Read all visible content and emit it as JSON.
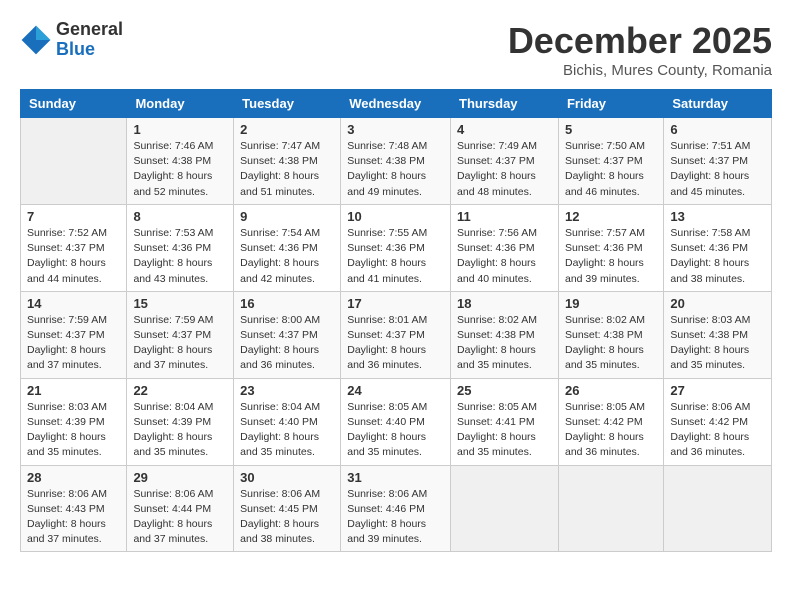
{
  "logo": {
    "general": "General",
    "blue": "Blue"
  },
  "title": "December 2025",
  "subtitle": "Bichis, Mures County, Romania",
  "days_of_week": [
    "Sunday",
    "Monday",
    "Tuesday",
    "Wednesday",
    "Thursday",
    "Friday",
    "Saturday"
  ],
  "weeks": [
    [
      {
        "day": "",
        "info": ""
      },
      {
        "day": "1",
        "info": "Sunrise: 7:46 AM\nSunset: 4:38 PM\nDaylight: 8 hours\nand 52 minutes."
      },
      {
        "day": "2",
        "info": "Sunrise: 7:47 AM\nSunset: 4:38 PM\nDaylight: 8 hours\nand 51 minutes."
      },
      {
        "day": "3",
        "info": "Sunrise: 7:48 AM\nSunset: 4:38 PM\nDaylight: 8 hours\nand 49 minutes."
      },
      {
        "day": "4",
        "info": "Sunrise: 7:49 AM\nSunset: 4:37 PM\nDaylight: 8 hours\nand 48 minutes."
      },
      {
        "day": "5",
        "info": "Sunrise: 7:50 AM\nSunset: 4:37 PM\nDaylight: 8 hours\nand 46 minutes."
      },
      {
        "day": "6",
        "info": "Sunrise: 7:51 AM\nSunset: 4:37 PM\nDaylight: 8 hours\nand 45 minutes."
      }
    ],
    [
      {
        "day": "7",
        "info": "Sunrise: 7:52 AM\nSunset: 4:37 PM\nDaylight: 8 hours\nand 44 minutes."
      },
      {
        "day": "8",
        "info": "Sunrise: 7:53 AM\nSunset: 4:36 PM\nDaylight: 8 hours\nand 43 minutes."
      },
      {
        "day": "9",
        "info": "Sunrise: 7:54 AM\nSunset: 4:36 PM\nDaylight: 8 hours\nand 42 minutes."
      },
      {
        "day": "10",
        "info": "Sunrise: 7:55 AM\nSunset: 4:36 PM\nDaylight: 8 hours\nand 41 minutes."
      },
      {
        "day": "11",
        "info": "Sunrise: 7:56 AM\nSunset: 4:36 PM\nDaylight: 8 hours\nand 40 minutes."
      },
      {
        "day": "12",
        "info": "Sunrise: 7:57 AM\nSunset: 4:36 PM\nDaylight: 8 hours\nand 39 minutes."
      },
      {
        "day": "13",
        "info": "Sunrise: 7:58 AM\nSunset: 4:36 PM\nDaylight: 8 hours\nand 38 minutes."
      }
    ],
    [
      {
        "day": "14",
        "info": "Sunrise: 7:59 AM\nSunset: 4:37 PM\nDaylight: 8 hours\nand 37 minutes."
      },
      {
        "day": "15",
        "info": "Sunrise: 7:59 AM\nSunset: 4:37 PM\nDaylight: 8 hours\nand 37 minutes."
      },
      {
        "day": "16",
        "info": "Sunrise: 8:00 AM\nSunset: 4:37 PM\nDaylight: 8 hours\nand 36 minutes."
      },
      {
        "day": "17",
        "info": "Sunrise: 8:01 AM\nSunset: 4:37 PM\nDaylight: 8 hours\nand 36 minutes."
      },
      {
        "day": "18",
        "info": "Sunrise: 8:02 AM\nSunset: 4:38 PM\nDaylight: 8 hours\nand 35 minutes."
      },
      {
        "day": "19",
        "info": "Sunrise: 8:02 AM\nSunset: 4:38 PM\nDaylight: 8 hours\nand 35 minutes."
      },
      {
        "day": "20",
        "info": "Sunrise: 8:03 AM\nSunset: 4:38 PM\nDaylight: 8 hours\nand 35 minutes."
      }
    ],
    [
      {
        "day": "21",
        "info": "Sunrise: 8:03 AM\nSunset: 4:39 PM\nDaylight: 8 hours\nand 35 minutes."
      },
      {
        "day": "22",
        "info": "Sunrise: 8:04 AM\nSunset: 4:39 PM\nDaylight: 8 hours\nand 35 minutes."
      },
      {
        "day": "23",
        "info": "Sunrise: 8:04 AM\nSunset: 4:40 PM\nDaylight: 8 hours\nand 35 minutes."
      },
      {
        "day": "24",
        "info": "Sunrise: 8:05 AM\nSunset: 4:40 PM\nDaylight: 8 hours\nand 35 minutes."
      },
      {
        "day": "25",
        "info": "Sunrise: 8:05 AM\nSunset: 4:41 PM\nDaylight: 8 hours\nand 35 minutes."
      },
      {
        "day": "26",
        "info": "Sunrise: 8:05 AM\nSunset: 4:42 PM\nDaylight: 8 hours\nand 36 minutes."
      },
      {
        "day": "27",
        "info": "Sunrise: 8:06 AM\nSunset: 4:42 PM\nDaylight: 8 hours\nand 36 minutes."
      }
    ],
    [
      {
        "day": "28",
        "info": "Sunrise: 8:06 AM\nSunset: 4:43 PM\nDaylight: 8 hours\nand 37 minutes."
      },
      {
        "day": "29",
        "info": "Sunrise: 8:06 AM\nSunset: 4:44 PM\nDaylight: 8 hours\nand 37 minutes."
      },
      {
        "day": "30",
        "info": "Sunrise: 8:06 AM\nSunset: 4:45 PM\nDaylight: 8 hours\nand 38 minutes."
      },
      {
        "day": "31",
        "info": "Sunrise: 8:06 AM\nSunset: 4:46 PM\nDaylight: 8 hours\nand 39 minutes."
      },
      {
        "day": "",
        "info": ""
      },
      {
        "day": "",
        "info": ""
      },
      {
        "day": "",
        "info": ""
      }
    ]
  ]
}
